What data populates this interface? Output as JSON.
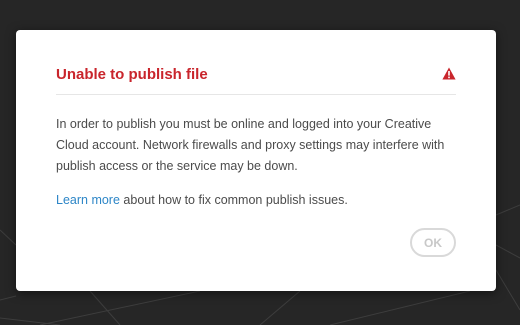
{
  "dialog": {
    "title": "Unable to publish file",
    "title_color": "#c9252c",
    "icon": "warning-icon",
    "message": "In order to publish you must be online and logged into your Creative Cloud account. Network firewalls and proxy settings may interfere with publish access or the service may be down.",
    "help_link_label": "Learn more",
    "help_text": " about how to fix common publish issues.",
    "link_color": "#2d86c7",
    "ok_label": "OK"
  }
}
